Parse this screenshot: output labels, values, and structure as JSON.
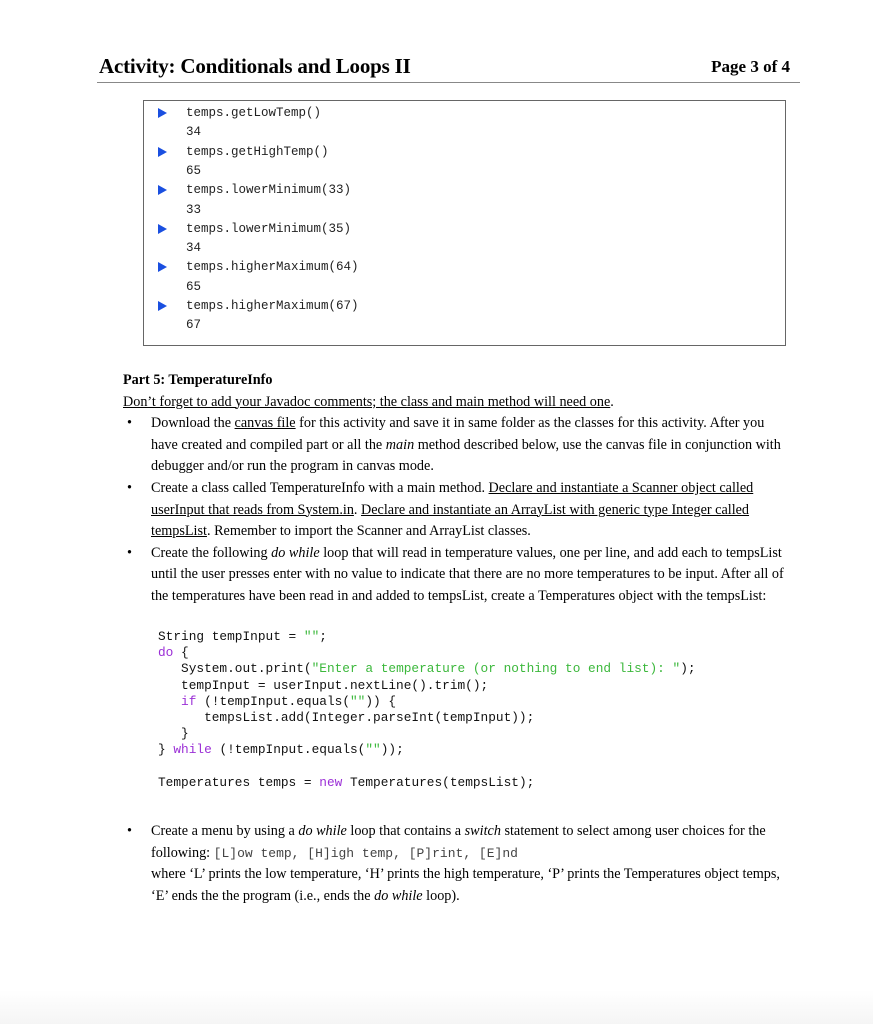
{
  "header": {
    "title": "Activity: Conditionals and Loops II",
    "page": "Page 3 of 4"
  },
  "console": [
    {
      "call": "temps.getLowTemp()",
      "result": "34"
    },
    {
      "call": "temps.getHighTemp()",
      "result": "65"
    },
    {
      "call": "temps.lowerMinimum(33)",
      "result": "33"
    },
    {
      "call": "temps.lowerMinimum(35)",
      "result": "34"
    },
    {
      "call": "temps.higherMaximum(64)",
      "result": "65"
    },
    {
      "call": "temps.higherMaximum(67)",
      "result": "67"
    }
  ],
  "part5": {
    "title": "Part 5: TemperatureInfo",
    "note": "Don’t forget to add your Javadoc comments; the class and main method will need one",
    "note_end": ".",
    "bullet1": {
      "a": "Download the ",
      "link": "canvas file",
      "b": " for this activity and save it in same folder as the classes for this activity. After you have created and compiled part or all the ",
      "main": "main",
      "c": " method described below, use the canvas file in conjunction with debugger and/or run the program in canvas mode."
    },
    "bullet2": {
      "a": "Create a class called TemperatureInfo with a main method.  ",
      "u1": "Declare and instantiate a Scanner object called userInput that reads from System.in",
      "b": ".  ",
      "u2": "Declare and instantiate an ArrayList with generic type Integer called tempsList",
      "c": ".  Remember to import the Scanner and ArrayList classes."
    },
    "bullet3": {
      "a": "Create the following ",
      "dowhile": "do while",
      "b": " loop that will read in temperature values, one per line, and add each to tempsList until the user presses enter with no value to indicate that there are no more temperatures to be input. After all of the temperatures have been read in and added to tempsList, create a Temperatures object with the tempsList:"
    },
    "code": {
      "l1a": "String tempInput = ",
      "l1s": "\"\"",
      "l1b": ";",
      "l2k": "do",
      "l2b": " {",
      "l3a": "   System.out.print(",
      "l3s": "\"Enter a temperature (or nothing to end list): \"",
      "l3b": ");",
      "l4": "   tempInput = userInput.nextLine().trim();",
      "l5i": "   ",
      "l5k": "if",
      "l5a": " (!tempInput.equals(",
      "l5s": "\"\"",
      "l5b": ")) {",
      "l6": "      tempsList.add(Integer.parseInt(tempInput));",
      "l7": "   }",
      "l8a": "} ",
      "l8k": "while",
      "l8b": " (!tempInput.equals(",
      "l8s": "\"\"",
      "l8c": "));",
      "l10a": "Temperatures temps = ",
      "l10k": "new",
      "l10b": " Temperatures(tempsList);"
    },
    "bullet4": {
      "a": "Create a menu by using a ",
      "dowhile": "do while",
      "b": " loop that contains a ",
      "switch": "switch",
      "c": " statement to select among user choices for the following: ",
      "menu": "[L]ow temp, [H]igh temp, [P]rint, [E]nd",
      "d": "where ‘L’ prints the low temperature, ‘H’ prints the high temperature, ‘P’ prints the Temperatures object temps, ‘E’ ends the the program (i.e., ends the ",
      "dowhile2": "do while",
      "e": " loop)."
    }
  },
  "colors": {
    "arrow": "#1a4fe0",
    "keyword": "#9b2fd6",
    "string": "#3cb83c"
  }
}
